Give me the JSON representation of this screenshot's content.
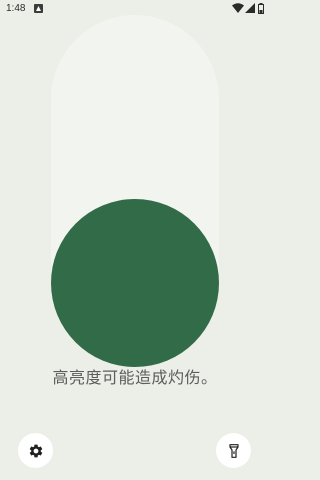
{
  "status_bar": {
    "time": "1:48",
    "notification_icon": "android-notification-icon",
    "wifi_icon": "wifi-icon",
    "signal_icon": "cell-signal-icon",
    "battery_icon": "battery-icon"
  },
  "slider": {
    "level": 0.0
  },
  "warning_text": "高亮度可能造成灼伤。",
  "buttons": {
    "settings_icon": "gear-icon",
    "flashlight_icon": "flashlight-icon"
  },
  "colors": {
    "background": "#eceee8",
    "track": "#f1f4ef",
    "thumb": "#326b47"
  }
}
